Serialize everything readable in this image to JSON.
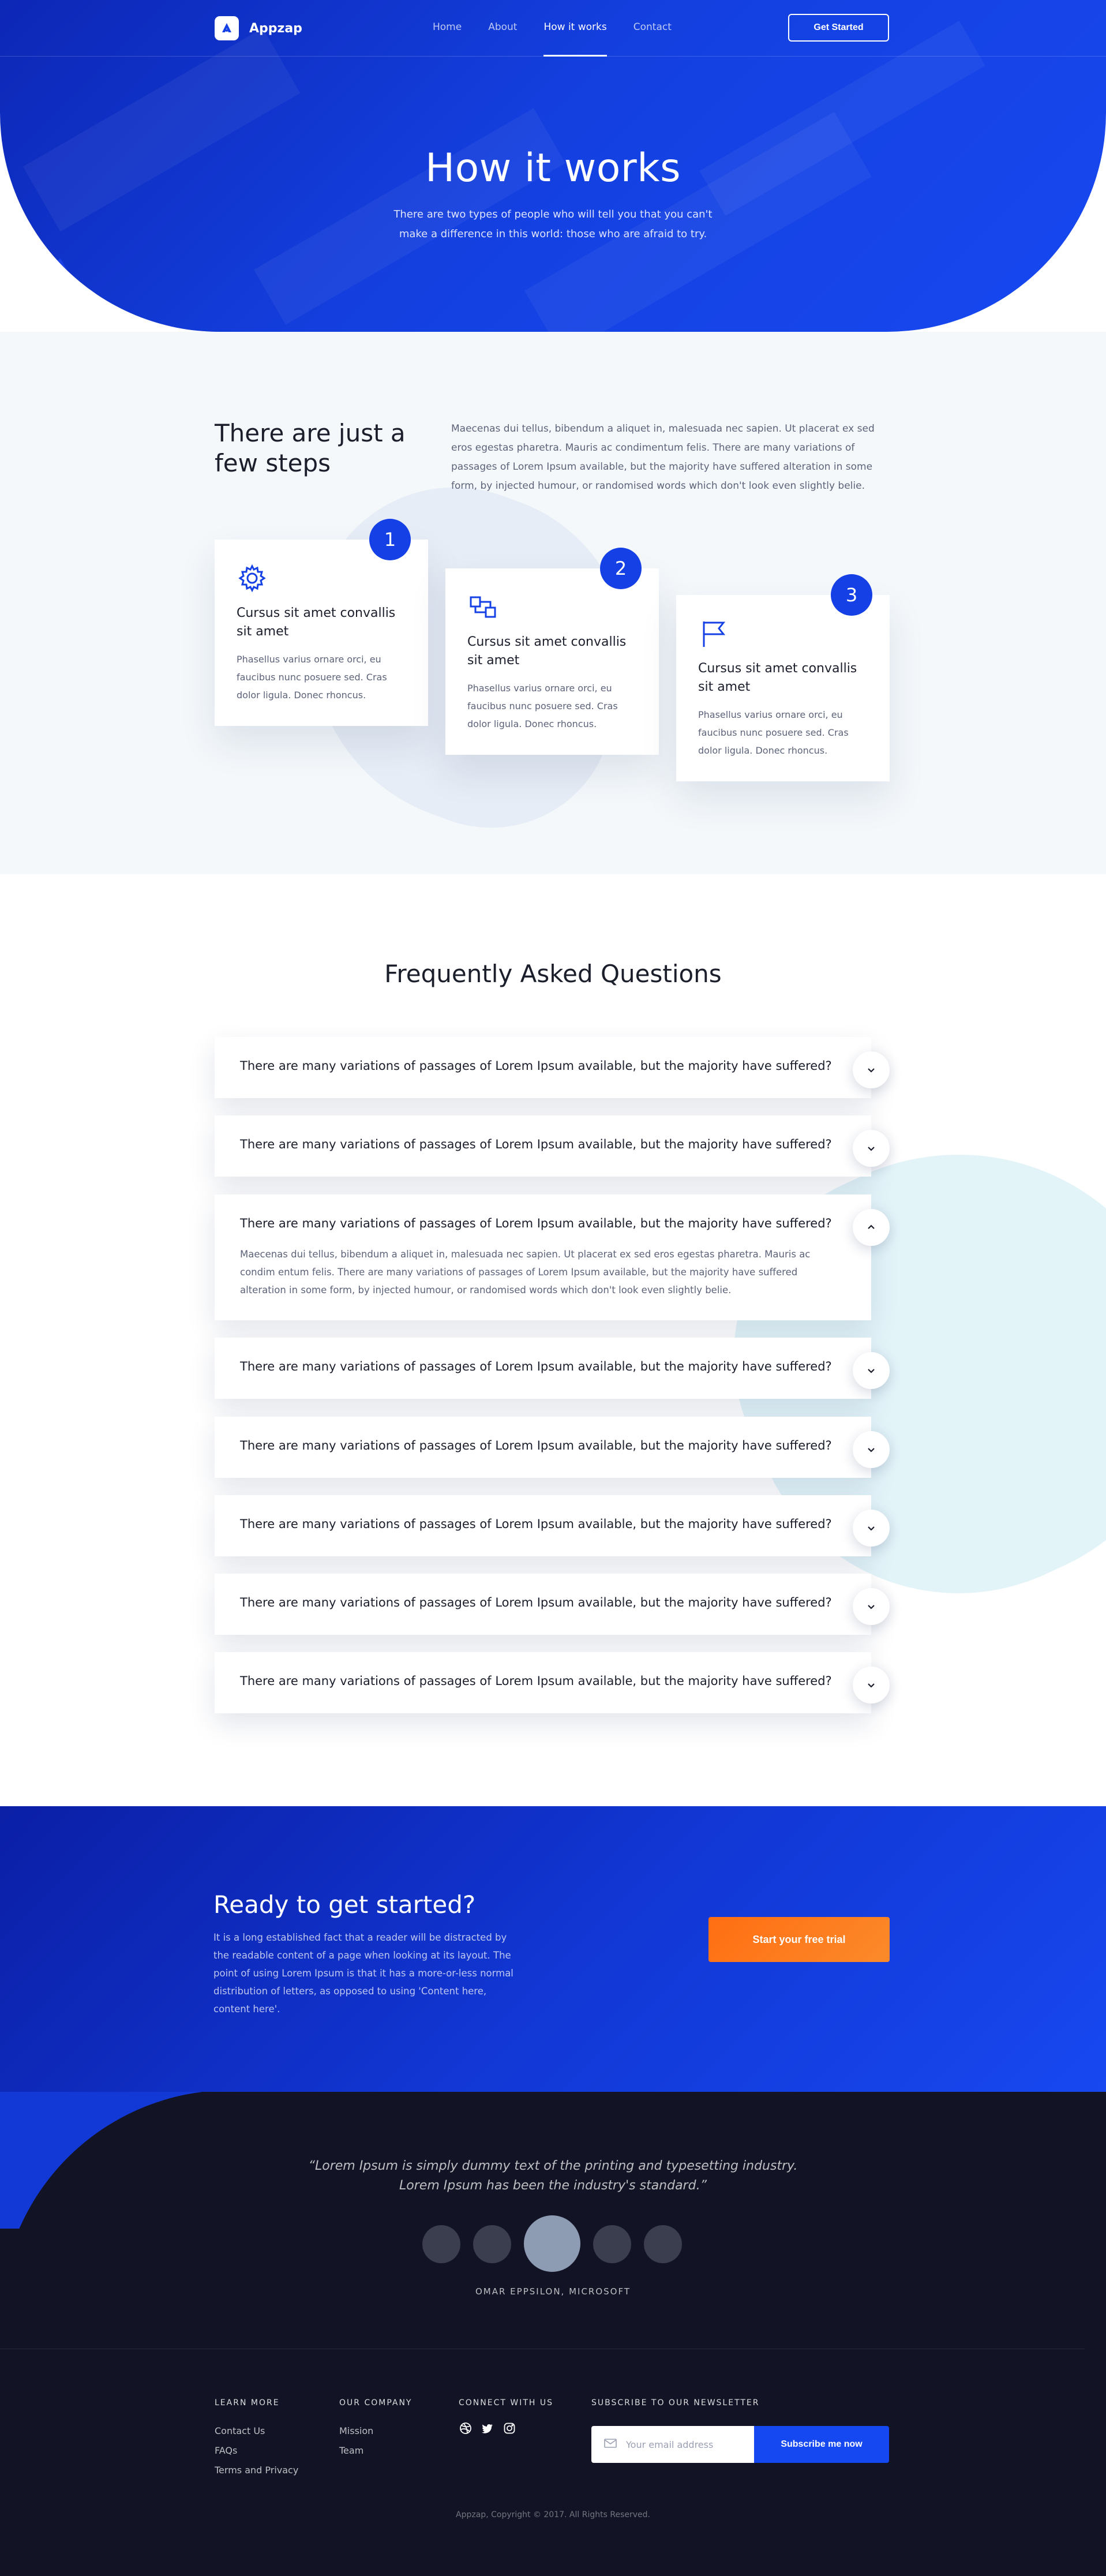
{
  "nav": {
    "brand": "Appzap",
    "links": [
      "Home",
      "About",
      "How it works",
      "Contact"
    ],
    "active_link": "How it works",
    "cta": "Get Started"
  },
  "hero": {
    "title": "How it works",
    "subtitle": "There are two types of people who will tell you that you can't make a difference in this world: those who are afraid to try."
  },
  "steps": {
    "title": "There are just a few steps",
    "intro": "Maecenas dui tellus, bibendum a aliquet in, malesuada nec sapien. Ut placerat ex sed eros egestas pharetra. Mauris ac condimentum felis. There are many variations of passages of Lorem Ipsum available, but the majority have suffered alteration in some form, by injected humour, or randomised words which don't look even slightly belie.",
    "cards": [
      {
        "number": "1",
        "icon": "gear-icon",
        "title": "Cursus sit amet convallis sit amet",
        "text": "Phasellus varius ornare orci, eu faucibus nunc posuere sed. Cras dolor ligula. Donec rhoncus."
      },
      {
        "number": "2",
        "icon": "connect-icon",
        "title": "Cursus sit amet convallis sit amet",
        "text": "Phasellus varius ornare orci, eu faucibus nunc posuere sed. Cras dolor ligula. Donec rhoncus."
      },
      {
        "number": "3",
        "icon": "flag-icon",
        "title": "Cursus sit amet convallis sit amet",
        "text": "Phasellus varius ornare orci, eu faucibus nunc posuere sed. Cras dolor ligula. Donec rhoncus."
      }
    ]
  },
  "faq": {
    "title": "Frequently Asked Questions",
    "items": [
      {
        "question": "There are many variations of passages of Lorem Ipsum available, but the majority have suffered?",
        "expanded": false,
        "answer": ""
      },
      {
        "question": "There are many variations of passages of Lorem Ipsum available, but the majority have suffered?",
        "expanded": false,
        "answer": ""
      },
      {
        "question": "There are many variations of passages of Lorem Ipsum available, but the majority have suffered?",
        "expanded": true,
        "answer": "Maecenas dui tellus, bibendum a aliquet in, malesuada nec sapien. Ut placerat ex sed eros egestas pharetra. Mauris ac condim entum felis. There are many variations of passages of Lorem Ipsum available, but the majority have suffered alteration in some form, by injected humour, or randomised words which don't look even slightly belie."
      },
      {
        "question": "There are many variations of passages of Lorem Ipsum available, but the majority have suffered?",
        "expanded": false,
        "answer": ""
      },
      {
        "question": "There are many variations of passages of Lorem Ipsum available, but the majority have suffered?",
        "expanded": false,
        "answer": ""
      },
      {
        "question": "There are many variations of passages of Lorem Ipsum available, but the majority have suffered?",
        "expanded": false,
        "answer": ""
      },
      {
        "question": "There are many variations of passages of Lorem Ipsum available, but the majority have suffered?",
        "expanded": false,
        "answer": ""
      },
      {
        "question": "There are many variations of passages of Lorem Ipsum available, but the majority have suffered?",
        "expanded": false,
        "answer": ""
      }
    ]
  },
  "cta": {
    "title": "Ready to get started?",
    "text": "It is a long established fact that a reader will be distracted by the readable content of a page when looking at its layout. The point of using Lorem Ipsum is that it has a more-or-less normal distribution of letters, as opposed to using 'Content here, content here'.",
    "button": "Start your free trial"
  },
  "testimonial": {
    "quote": "“Lorem Ipsum is simply dummy text of the printing and typesetting industry. Lorem Ipsum has been the industry's standard.”",
    "author": "OMAR EPPSILON, MICROSOFT",
    "avatars_count": 5,
    "active_avatar": 3
  },
  "footer": {
    "learn_more": {
      "title": "LEARN MORE",
      "links": [
        "Contact Us",
        "FAQs",
        "Terms and Privacy"
      ]
    },
    "company": {
      "title": "OUR COMPANY",
      "links": [
        "Mission",
        "Team"
      ]
    },
    "connect": {
      "title": "CONNECT WITH US",
      "icons": [
        "dribbble-icon",
        "twitter-icon",
        "instagram-icon"
      ]
    },
    "newsletter": {
      "title": "SUBSCRIBE TO OUR NEWSLETTER",
      "placeholder": "Your email address",
      "button": "Subscribe me now"
    },
    "copyright": "Appzap, Copyright © 2017. All Rights Reserved."
  },
  "colors": {
    "primary": "#1440e6",
    "primary_dark": "#0a1fa8",
    "accent_orange": "#ff6e12",
    "dark_bg": "#121426",
    "light_bg": "#f4f8fb"
  }
}
